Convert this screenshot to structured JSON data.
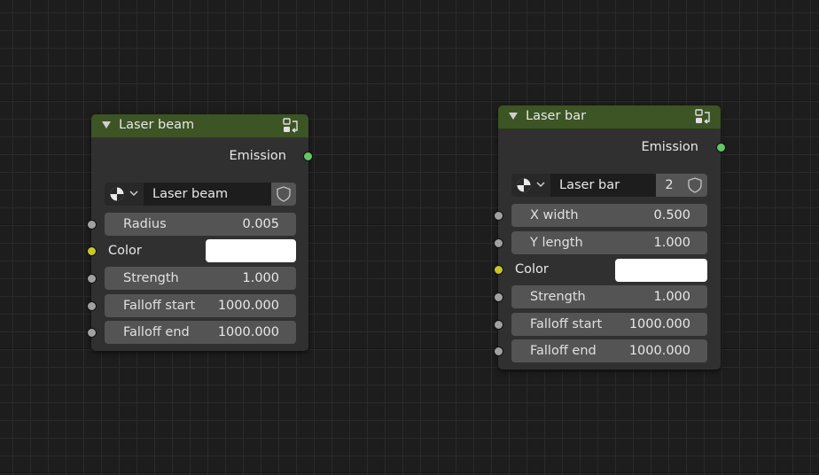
{
  "nodes": [
    {
      "title": "Laser beam",
      "output_label": "Emission",
      "datablock": {
        "name": "Laser beam",
        "user_count": ""
      },
      "fields": [
        {
          "label": "Radius",
          "value": "0.005"
        },
        {
          "label": "Strength",
          "value": "1.000"
        },
        {
          "label": "Falloff start",
          "value": "1000.000"
        },
        {
          "label": "Falloff end",
          "value": "1000.000"
        }
      ],
      "color": {
        "label": "Color",
        "swatch": "#ffffff"
      }
    },
    {
      "title": "Laser bar",
      "output_label": "Emission",
      "datablock": {
        "name": "Laser bar",
        "user_count": "2"
      },
      "fields": [
        {
          "label": "X width",
          "value": "0.500"
        },
        {
          "label": "Y length",
          "value": "1.000"
        },
        {
          "label": "Strength",
          "value": "1.000"
        },
        {
          "label": "Falloff start",
          "value": "1000.000"
        },
        {
          "label": "Falloff end",
          "value": "1000.000"
        }
      ],
      "color": {
        "label": "Color",
        "swatch": "#ffffff"
      }
    }
  ],
  "theme": {
    "canvas_bg": "#1d1d1d",
    "header_green": "#3d5425",
    "socket_emission": "#63c763",
    "socket_float": "#a1a1a1",
    "socket_color": "#c7c729"
  },
  "icons": [
    "collapse-triangle-icon",
    "node-group-icon",
    "material-ball-icon",
    "chevron-down-icon",
    "fake-user-shield-icon"
  ]
}
